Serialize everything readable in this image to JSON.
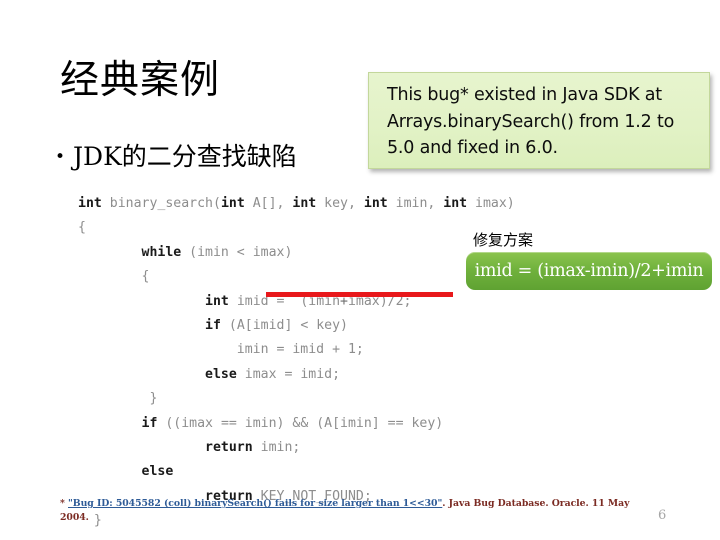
{
  "slide": {
    "title": "经典案例",
    "page_number": "6",
    "bullets": [
      {
        "marker": "•",
        "text": "JDK的二分查找缺陷"
      }
    ],
    "callout": {
      "text": "This bug* existed in Java SDK at Arrays.binarySearch() from 1.2 to 5.0 and fixed in 6.0.",
      "background_color": "#e3f2c8",
      "border_color": "#c3d79b",
      "text_color": "#0d0d0d"
    },
    "fix": {
      "label": "修复方案",
      "expression": "imid = (imax-imin)/2+imin",
      "box_color": "#71b23d",
      "text_color": "#ffffff"
    },
    "highlight": {
      "color": "#e8181b",
      "target_line_index": 4
    },
    "code": {
      "language": "C",
      "lines": [
        [
          {
            "t": "int ",
            "k": "kw"
          },
          {
            "t": "binary_search",
            "k": "id"
          },
          {
            "t": "(",
            "k": "id"
          },
          {
            "t": "int",
            "k": "kw"
          },
          {
            "t": " A[], ",
            "k": "id"
          },
          {
            "t": "int",
            "k": "kw"
          },
          {
            "t": " key, ",
            "k": "id"
          },
          {
            "t": "int",
            "k": "kw"
          },
          {
            "t": " imin, ",
            "k": "id"
          },
          {
            "t": "int",
            "k": "kw"
          },
          {
            "t": " imax)",
            "k": "id"
          }
        ],
        [
          {
            "t": "{",
            "k": "id"
          }
        ],
        [
          {
            "t": "        ",
            "k": "id"
          },
          {
            "t": "while",
            "k": "kw"
          },
          {
            "t": " (imin < imax)",
            "k": "id"
          }
        ],
        [
          {
            "t": "        {",
            "k": "id"
          }
        ],
        [
          {
            "t": "                ",
            "k": "id"
          },
          {
            "t": "int",
            "k": "kw"
          },
          {
            "t": " imid =  (imin",
            "k": "id"
          },
          {
            "t": "+",
            "k": "id-dk"
          },
          {
            "t": "imax)/2;",
            "k": "id"
          }
        ],
        [
          {
            "t": "                ",
            "k": "id"
          },
          {
            "t": "if",
            "k": "kw"
          },
          {
            "t": " (A[imid] < key)",
            "k": "id"
          }
        ],
        [
          {
            "t": "                    imin = imid + 1;",
            "k": "id"
          }
        ],
        [
          {
            "t": "                ",
            "k": "id"
          },
          {
            "t": "else",
            "k": "kw"
          },
          {
            "t": " imax = imid;",
            "k": "id"
          }
        ],
        [
          {
            "t": "         }",
            "k": "id"
          }
        ],
        [
          {
            "t": "        ",
            "k": "id"
          },
          {
            "t": "if",
            "k": "kw"
          },
          {
            "t": " ((imax == imin) && (A[imin] == key)",
            "k": "id"
          }
        ],
        [
          {
            "t": "                ",
            "k": "id"
          },
          {
            "t": "return",
            "k": "kw"
          },
          {
            "t": " imin;",
            "k": "id"
          }
        ],
        [
          {
            "t": "        ",
            "k": "id"
          },
          {
            "t": "else",
            "k": "kw"
          }
        ],
        [
          {
            "t": "                ",
            "k": "id"
          },
          {
            "t": "return",
            "k": "kw"
          },
          {
            "t": " KEY_NOT_FOUND;",
            "k": "id"
          }
        ],
        [
          {
            "t": "  }",
            "k": "id"
          }
        ]
      ]
    },
    "footnote": {
      "prefix": "* ",
      "link_text": "\"Bug ID: 5045582 (coll) binarySearch() fails for size larger than 1<<30\"",
      "suffix": ". Java Bug Database. Oracle. 11 May 2004.",
      "link_color": "#2e5b97",
      "text_color": "#7b2b23"
    }
  }
}
